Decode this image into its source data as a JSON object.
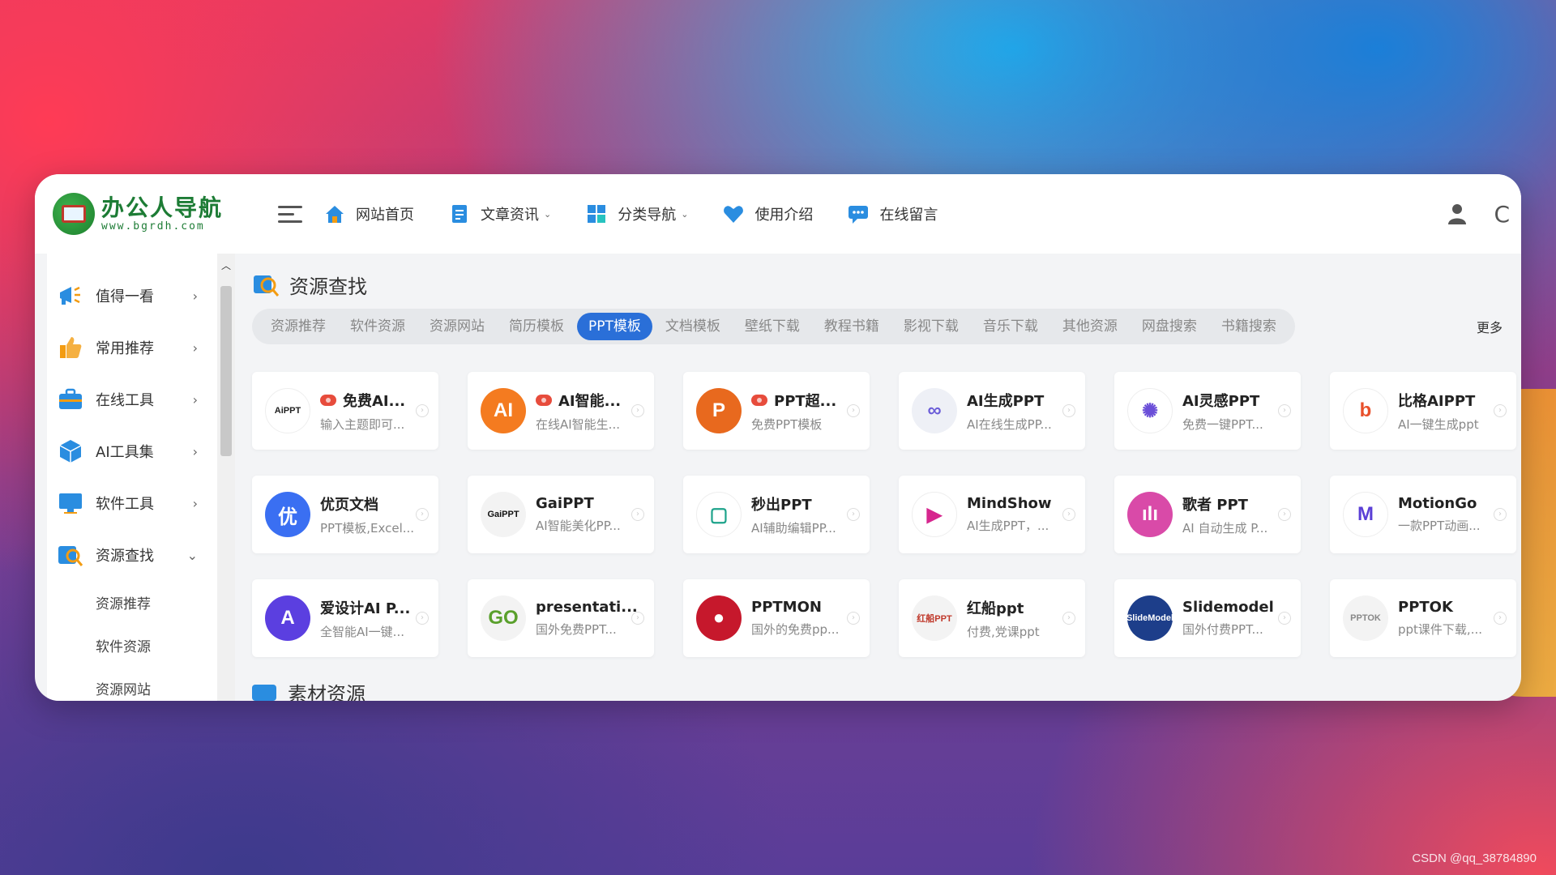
{
  "logo": {
    "title": "办公人导航",
    "subtitle": "www.bgrdh.com"
  },
  "nav": [
    {
      "label": "网站首页",
      "icon": "home-icon",
      "has_caret": false
    },
    {
      "label": "文章资讯",
      "icon": "document-icon",
      "has_caret": true
    },
    {
      "label": "分类导航",
      "icon": "grid-icon",
      "has_caret": true
    },
    {
      "label": "使用介绍",
      "icon": "heart-icon",
      "has_caret": false
    },
    {
      "label": "在线留言",
      "icon": "chat-icon",
      "has_caret": false
    }
  ],
  "sidebar": {
    "items": [
      {
        "label": "值得一看",
        "icon": "megaphone-icon",
        "expanded": false
      },
      {
        "label": "常用推荐",
        "icon": "thumbs-up-icon",
        "expanded": false
      },
      {
        "label": "在线工具",
        "icon": "toolbox-icon",
        "expanded": false
      },
      {
        "label": "AI工具集",
        "icon": "cube-icon",
        "expanded": false
      },
      {
        "label": "软件工具",
        "icon": "monitor-icon",
        "expanded": false
      },
      {
        "label": "资源查找",
        "icon": "search-icon",
        "expanded": true
      }
    ],
    "subitems": [
      "资源推荐",
      "软件资源",
      "资源网站"
    ]
  },
  "section": {
    "title": "资源查找",
    "next_title": "素材资源"
  },
  "tabs": [
    "资源推荐",
    "软件资源",
    "资源网站",
    "简历模板",
    "PPT模板",
    "文档模板",
    "壁纸下载",
    "教程书籍",
    "影视下载",
    "音乐下载",
    "其他资源",
    "网盘搜索",
    "书籍搜索"
  ],
  "active_tab": "PPT模板",
  "more_label": "更多",
  "cards": [
    {
      "name": "免费AI...",
      "desc": "输入主题即可...",
      "logo": "AiPPT",
      "bg": "#ffffff",
      "fg": "#222222",
      "hot": true
    },
    {
      "name": "AI智能...",
      "desc": "在线AI智能生...",
      "logo": "AI",
      "bg": "#f47b20",
      "fg": "#ffffff",
      "hot": true
    },
    {
      "name": "PPT超...",
      "desc": "免费PPT模板",
      "logo": "P",
      "bg": "#e8691e",
      "fg": "#ffffff",
      "hot": true
    },
    {
      "name": "AI生成PPT",
      "desc": "AI在线生成PP...",
      "logo": "∞",
      "bg": "#eef0f6",
      "fg": "#6a5cd8",
      "hot": false
    },
    {
      "name": "AI灵感PPT",
      "desc": "免费一键PPT...",
      "logo": "✺",
      "bg": "#ffffff",
      "fg": "#6b4fd8",
      "hot": false
    },
    {
      "name": "比格AIPPT",
      "desc": "AI一键生成ppt",
      "logo": "b",
      "bg": "#ffffff",
      "fg": "#e8502b",
      "hot": false
    },
    {
      "name": "优页文档",
      "desc": "PPT模板,Excel...",
      "logo": "优",
      "bg": "#3a6ff2",
      "fg": "#ffffff",
      "hot": false
    },
    {
      "name": "GaiPPT",
      "desc": "AI智能美化PP...",
      "logo": "GaiPPT",
      "bg": "#f3f3f3",
      "fg": "#111111",
      "hot": false
    },
    {
      "name": "秒出PPT",
      "desc": "AI辅助编辑PP...",
      "logo": "▢",
      "bg": "#ffffff",
      "fg": "#1ea38b",
      "hot": false
    },
    {
      "name": "MindShow",
      "desc": "AI生成PPT，...",
      "logo": "▶",
      "bg": "#ffffff",
      "fg": "#d6268e",
      "hot": false
    },
    {
      "name": "歌者 PPT",
      "desc": "AI 自动生成 P...",
      "logo": "ılı",
      "bg": "#d94aa8",
      "fg": "#ffffff",
      "hot": false
    },
    {
      "name": "MotionGo",
      "desc": "一款PPT动画...",
      "logo": "M",
      "bg": "#ffffff",
      "fg": "#5b3fd6",
      "hot": false
    },
    {
      "name": "爱设计AI P...",
      "desc": "全智能AI一键...",
      "logo": "A",
      "bg": "#5b3fe0",
      "fg": "#ffffff",
      "hot": false
    },
    {
      "name": "presentati...",
      "desc": "国外免费PPT...",
      "logo": "GO",
      "bg": "#f3f3f3",
      "fg": "#5aa02c",
      "hot": false
    },
    {
      "name": "PPTMON",
      "desc": "国外的免费pp...",
      "logo": "●",
      "bg": "#c6182c",
      "fg": "#ffffff",
      "hot": false
    },
    {
      "name": "红船ppt",
      "desc": "付费,党课ppt",
      "logo": "红船PPT",
      "bg": "#f3f3f3",
      "fg": "#c0392b",
      "hot": false
    },
    {
      "name": "Slidemodel",
      "desc": "国外付费PPT...",
      "logo": "SlideModel",
      "bg": "#1d3e8a",
      "fg": "#ffffff",
      "hot": false
    },
    {
      "name": "PPTOK",
      "desc": "ppt课件下载,...",
      "logo": "PPTOK",
      "bg": "#f3f3f3",
      "fg": "#888888",
      "hot": false
    }
  ],
  "watermark": "CSDN @qq_38784890"
}
